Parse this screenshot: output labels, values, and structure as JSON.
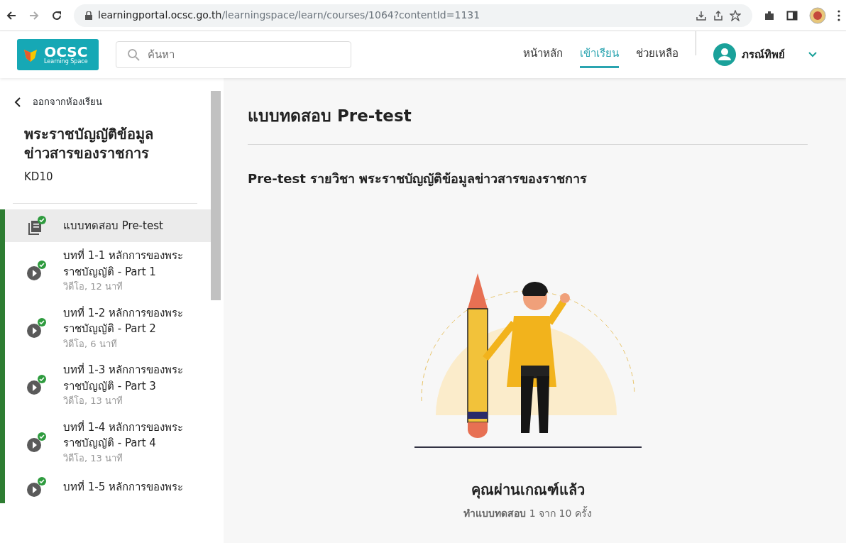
{
  "browser": {
    "url_host": "learningportal.ocsc.go.th",
    "url_path": "/learningspace/learn/courses/1064?contentId=1131"
  },
  "header": {
    "logo": {
      "title": "OCSC",
      "subtitle": "Learning Space"
    },
    "search": {
      "placeholder": "ค้นหา"
    },
    "nav": [
      {
        "label": "หน้าหลัก",
        "selected": false
      },
      {
        "label": "เข้าเรียน",
        "selected": true
      },
      {
        "label": "ช่วยเหลือ",
        "selected": false
      }
    ],
    "user": {
      "name": "ภรณ์ทิพย์"
    }
  },
  "sidebar": {
    "back": "ออกจากห้องเรียน",
    "course_title": "พระราชบัญญัติข้อมูลข่าวสารของราชการ",
    "course_code": "KD10",
    "items": [
      {
        "kind": "quiz",
        "title": "แบบทดสอบ Pre-test",
        "completed": true,
        "selected": true
      },
      {
        "kind": "video",
        "title": "บทที่ 1-1 หลักการของพระราชบัญญัติ - Part 1",
        "meta": "วิดีโอ, 12 นาที",
        "completed": true,
        "selected": false
      },
      {
        "kind": "video",
        "title": "บทที่ 1-2 หลักการของพระราชบัญญัติ - Part 2",
        "meta": "วิดีโอ, 6 นาที",
        "completed": true,
        "selected": false
      },
      {
        "kind": "video",
        "title": "บทที่ 1-3 หลักการของพระราชบัญญัติ - Part 3",
        "meta": "วิดีโอ, 13 นาที",
        "completed": true,
        "selected": false
      },
      {
        "kind": "video",
        "title": "บทที่ 1-4 หลักการของพระราชบัญญัติ - Part 4",
        "meta": "วิดีโอ, 13 นาที",
        "completed": true,
        "selected": false
      },
      {
        "kind": "video",
        "title": "บทที่ 1-5 หลักการของพระ",
        "completed": true,
        "selected": false
      }
    ]
  },
  "main": {
    "title": "แบบทดสอบ Pre-test",
    "subtitle": "Pre-test รายวิชา พระราชบัญญัติข้อมูลข่าวสารของราชการ",
    "result": "คุณผ่านเกณฑ์แล้ว",
    "attempts": "**ทำแบบทดสอบ** 1 จาก 10 ครั้ง"
  }
}
